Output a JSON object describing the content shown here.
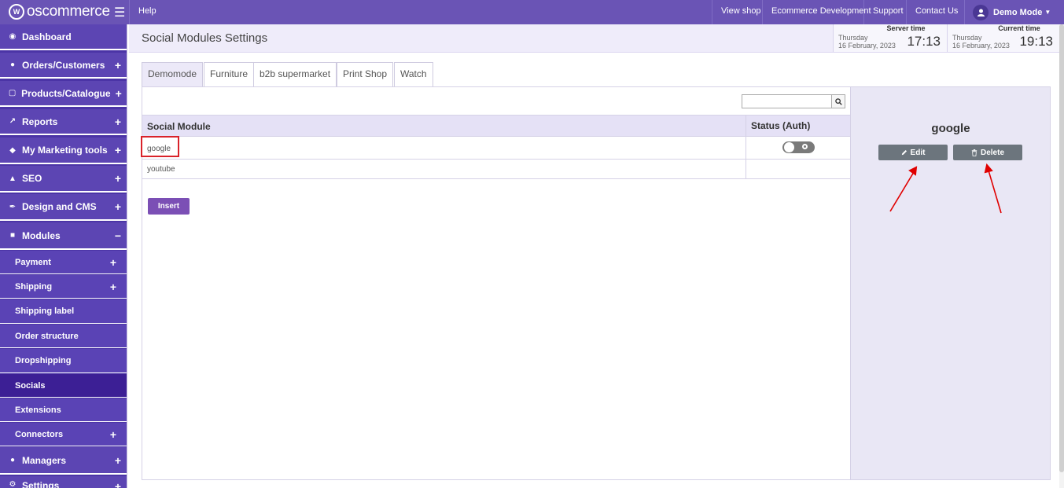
{
  "brand": {
    "name": "oscommerce"
  },
  "topnav": {
    "help": "Help",
    "items": [
      "View shop",
      "Ecommerce Development",
      "Support",
      "Contact Us"
    ],
    "user": "Demo Mode"
  },
  "sidebar": {
    "items": [
      {
        "label": "Dashboard",
        "icon": "dashboard-icon",
        "expand": ""
      },
      {
        "label": "Orders/Customers",
        "icon": "users-icon",
        "expand": "+"
      },
      {
        "label": "Products/Catalogue",
        "icon": "folder-icon",
        "expand": "+"
      },
      {
        "label": "Reports",
        "icon": "chart-icon",
        "expand": "+"
      },
      {
        "label": "My Marketing tools",
        "icon": "tag-icon",
        "expand": "+"
      },
      {
        "label": "SEO",
        "icon": "sitemap-icon",
        "expand": "+"
      },
      {
        "label": "Design and CMS",
        "icon": "brush-icon",
        "expand": "+"
      },
      {
        "label": "Modules",
        "icon": "puzzle-icon",
        "expand": "−"
      }
    ],
    "subitems": [
      {
        "label": "Payment",
        "expand": "+"
      },
      {
        "label": "Shipping",
        "expand": "+"
      },
      {
        "label": "Shipping label",
        "expand": ""
      },
      {
        "label": "Order structure",
        "expand": ""
      },
      {
        "label": "Dropshipping",
        "expand": ""
      },
      {
        "label": "Socials",
        "expand": ""
      },
      {
        "label": "Extensions",
        "expand": ""
      },
      {
        "label": "Connectors",
        "expand": "+"
      }
    ],
    "bottom": [
      {
        "label": "Managers",
        "icon": "user-icon",
        "expand": "+"
      },
      {
        "label": "Settings",
        "icon": "gears-icon",
        "expand": "+"
      }
    ]
  },
  "header": {
    "title": "Social Modules Settings",
    "server_time": {
      "caption": "Server time",
      "day": "Thursday",
      "date": "16 February, 2023",
      "time": "17:13"
    },
    "current_time": {
      "caption": "Current time",
      "day": "Thursday",
      "date": "16 February, 2023",
      "time": "19:13"
    }
  },
  "tabs": [
    "Demomode",
    "Furniture",
    "b2b supermarket",
    "Print Shop",
    "Watch"
  ],
  "table": {
    "search_placeholder": "",
    "columns": [
      "Social Module",
      "Status (Auth)"
    ],
    "rows": [
      {
        "name": "google",
        "status": "off"
      },
      {
        "name": "youtube",
        "status": ""
      }
    ],
    "insert_label": "Insert"
  },
  "detail": {
    "title": "google",
    "edit_label": "Edit",
    "delete_label": "Delete"
  },
  "colors": {
    "topbar": "#6a54b5",
    "sidebar": "#5c45b3",
    "sidebar_active": "#3c1f95",
    "insert_button": "#7b4fb5",
    "action_button": "#6c757d",
    "highlight": "#d9222a"
  }
}
